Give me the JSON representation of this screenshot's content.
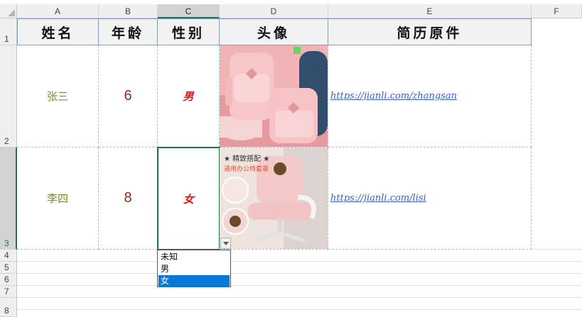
{
  "columns": [
    "A",
    "B",
    "C",
    "D",
    "E",
    "F"
  ],
  "rows": [
    "1",
    "2",
    "3",
    "4",
    "5",
    "6",
    "7",
    "8"
  ],
  "header_row": {
    "name": "姓名",
    "age": "年龄",
    "gender": "性别",
    "avatar": "头像",
    "resume": "简历原件"
  },
  "records": [
    {
      "name": "张三",
      "age": "6",
      "gender": "男",
      "resume_link": "https://jianli.com/zhangsan"
    },
    {
      "name": "李四",
      "age": "8",
      "gender": "女",
      "resume_link": "https://jianli.com/lisi"
    }
  ],
  "image2_caption": {
    "line1": "★ 精致搭配 ★",
    "line2": "通用办公椅套罩"
  },
  "dropdown": {
    "options": [
      "未知",
      "男",
      "女"
    ],
    "selected_index": 2
  },
  "colors": {
    "name_text": "#7a8c32",
    "age_text": "#8a2b20",
    "gender_text": "#e0141a",
    "link_text": "#3b5fc1",
    "selection": "#217346",
    "dropdown_highlight": "#0a78d7"
  }
}
